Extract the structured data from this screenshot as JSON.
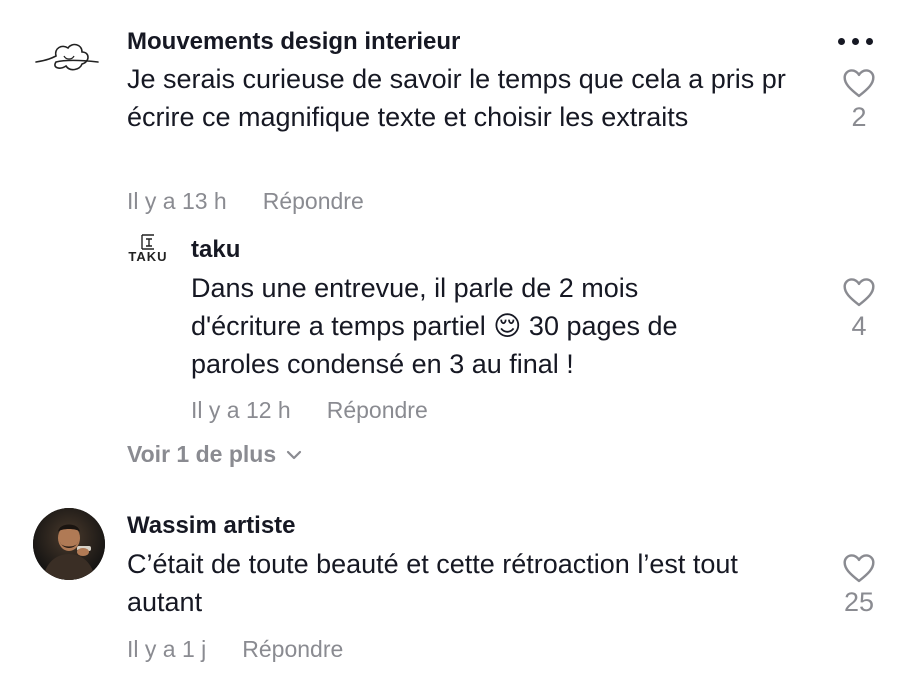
{
  "comments": [
    {
      "username": "Mouvements design interieur",
      "text": "Je serais curieuse de savoir le temps que cela a pris pr écrire ce magnifique texte et choisir les extraits",
      "time": "Il y a 13 h",
      "reply": "Répondre",
      "likes": "2"
    },
    {
      "username": "taku",
      "avatar_text": "TAKU",
      "text": "Dans une entrevue, il parle de 2 mois d'écriture a temps partiel 😌 30 pages de paroles condensé en 3 au final !",
      "time": "Il y a 12 h",
      "reply": "Répondre",
      "likes": "4"
    },
    {
      "username": "Wassim artiste",
      "text": "C’était de toute beauté et cette rétroaction l’est tout autant",
      "time": "Il y a 1 j",
      "reply": "Répondre",
      "likes": "25"
    }
  ],
  "view_more": "Voir 1 de plus",
  "icons": {
    "more": "more-options-icon",
    "like": "heart-outline-icon",
    "expand": "chevron-down-icon"
  },
  "colors": {
    "text": "#161823",
    "secondary": "#8a8b91"
  }
}
